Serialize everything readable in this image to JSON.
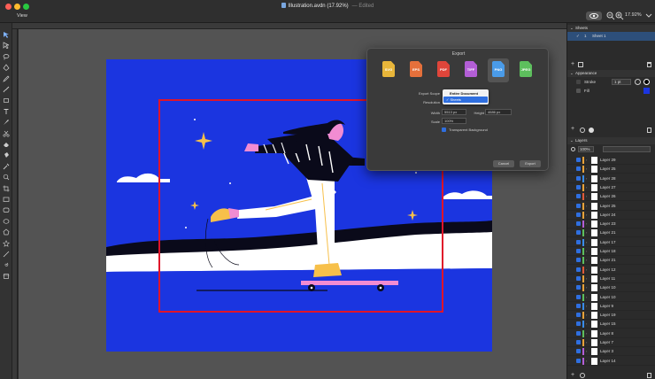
{
  "window": {
    "title": "Illustration.avdn (17.92%)",
    "subtitle": "— Edited",
    "view_menu": "View",
    "zoom": "17.92%"
  },
  "tools": [
    "select-icon",
    "direct-select-icon",
    "lasso-icon",
    "pen-icon",
    "pencil-icon",
    "brush-icon",
    "eraser-shape-icon",
    "text-icon",
    "knife-icon",
    "scissors-icon",
    "eraser-icon",
    "fill-icon",
    "eyedropper-icon",
    "zoom-tool-icon",
    "crop-icon",
    "rectangle-icon",
    "rounded-rectangle-icon",
    "ellipse-icon",
    "polygon-icon",
    "star-icon",
    "line-icon",
    "spiral-icon",
    "artboard-icon"
  ],
  "export_dialog": {
    "title": "Export",
    "formats": [
      {
        "label": "SVG",
        "color": "#e8b63a"
      },
      {
        "label": "EPS",
        "color": "#e5703b"
      },
      {
        "label": "PDF",
        "color": "#e0453a"
      },
      {
        "label": "TIFF",
        "color": "#b35ed6"
      },
      {
        "label": "PNG",
        "color": "#4a9be8"
      },
      {
        "label": "JPEG",
        "color": "#5dbf5d"
      }
    ],
    "selected_format": "PNG",
    "export_scope_label": "Export Scope",
    "resolution_label": "Resolution",
    "scope_options": [
      "Entire Document",
      "Sheets"
    ],
    "scope_selected": "Sheets",
    "width_label": "Width",
    "width_value": "5513 px",
    "height_label": "Height",
    "height_value": "4686 px",
    "scale_label": "Scale",
    "scale_value": "100%",
    "transparent_label": "Transparent Background",
    "cancel": "Cancel",
    "export": "Export"
  },
  "sheets_panel": {
    "title": "Sheets",
    "sheet_number": "1",
    "sheet_name": "Sheet 1"
  },
  "appearance_panel": {
    "title": "Appearance",
    "stroke_label": "Stroke",
    "stroke_width": "1 pt",
    "fill_label": "Fill",
    "fill_color": "#1b35e0"
  },
  "layers_panel": {
    "title": "Layers",
    "opacity": "100%",
    "layers": [
      {
        "name": "Layer 29",
        "color": "#e8a23a"
      },
      {
        "name": "Layer 25",
        "color": "#e8a23a"
      },
      {
        "name": "Layer 28",
        "color": "#3a8ce8"
      },
      {
        "name": "Layer 27",
        "color": "#e8a23a"
      },
      {
        "name": "Layer 26",
        "color": "#e05a3a"
      },
      {
        "name": "Layer 25",
        "color": "#e8a23a"
      },
      {
        "name": "Layer 24",
        "color": "#e8a23a"
      },
      {
        "name": "Layer 23",
        "color": "#b35ed6"
      },
      {
        "name": "Layer 21",
        "color": "#5dbf5d"
      },
      {
        "name": "Layer 17",
        "color": "#3a8ce8"
      },
      {
        "name": "Layer 18",
        "color": "#5dbf5d"
      },
      {
        "name": "Layer 21",
        "color": "#5dbf5d"
      },
      {
        "name": "Layer 12",
        "color": "#e05a3a"
      },
      {
        "name": "Layer 11",
        "color": "#e8a23a"
      },
      {
        "name": "Layer 10",
        "color": "#e8a23a"
      },
      {
        "name": "Layer 10",
        "color": "#5dbf5d"
      },
      {
        "name": "Layer 9",
        "color": "#3a8ce8"
      },
      {
        "name": "Layer 19",
        "color": "#e8a23a"
      },
      {
        "name": "Layer 15",
        "color": "#3a8ce8"
      },
      {
        "name": "Layer 8",
        "color": "#5dbf5d"
      },
      {
        "name": "Layer 7",
        "color": "#e8a23a"
      },
      {
        "name": "Layer 3",
        "color": "#b35ed6"
      },
      {
        "name": "Layer 14",
        "color": "#b35ed6"
      }
    ]
  }
}
